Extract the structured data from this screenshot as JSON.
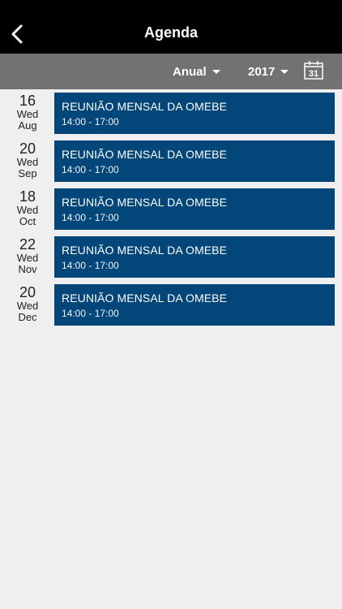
{
  "header": {
    "title": "Agenda"
  },
  "filters": {
    "period": "Anual",
    "year": "2017",
    "calendar_icon_day": "31"
  },
  "events": [
    {
      "day": "16",
      "weekday": "Wed",
      "month": "Aug",
      "title": "REUNIÃO MENSAL DA OMEBE",
      "time": "14:00 - 17:00"
    },
    {
      "day": "20",
      "weekday": "Wed",
      "month": "Sep",
      "title": "REUNIÃO MENSAL DA OMEBE",
      "time": "14:00 - 17:00"
    },
    {
      "day": "18",
      "weekday": "Wed",
      "month": "Oct",
      "title": "REUNIÃO MENSAL DA OMEBE",
      "time": "14:00 - 17:00"
    },
    {
      "day": "22",
      "weekday": "Wed",
      "month": "Nov",
      "title": "REUNIÃO MENSAL DA OMEBE",
      "time": "14:00 - 17:00"
    },
    {
      "day": "20",
      "weekday": "Wed",
      "month": "Dec",
      "title": "REUNIÃO MENSAL DA OMEBE",
      "time": "14:00 - 17:00"
    }
  ],
  "colors": {
    "header_bg": "#000000",
    "filter_bg": "#727272",
    "event_bg": "#03467a",
    "page_bg": "#efefef"
  },
  "icons": {
    "back": "chevron-left-icon",
    "calendar": "calendar-icon",
    "dropdown": "caret-down-icon"
  }
}
